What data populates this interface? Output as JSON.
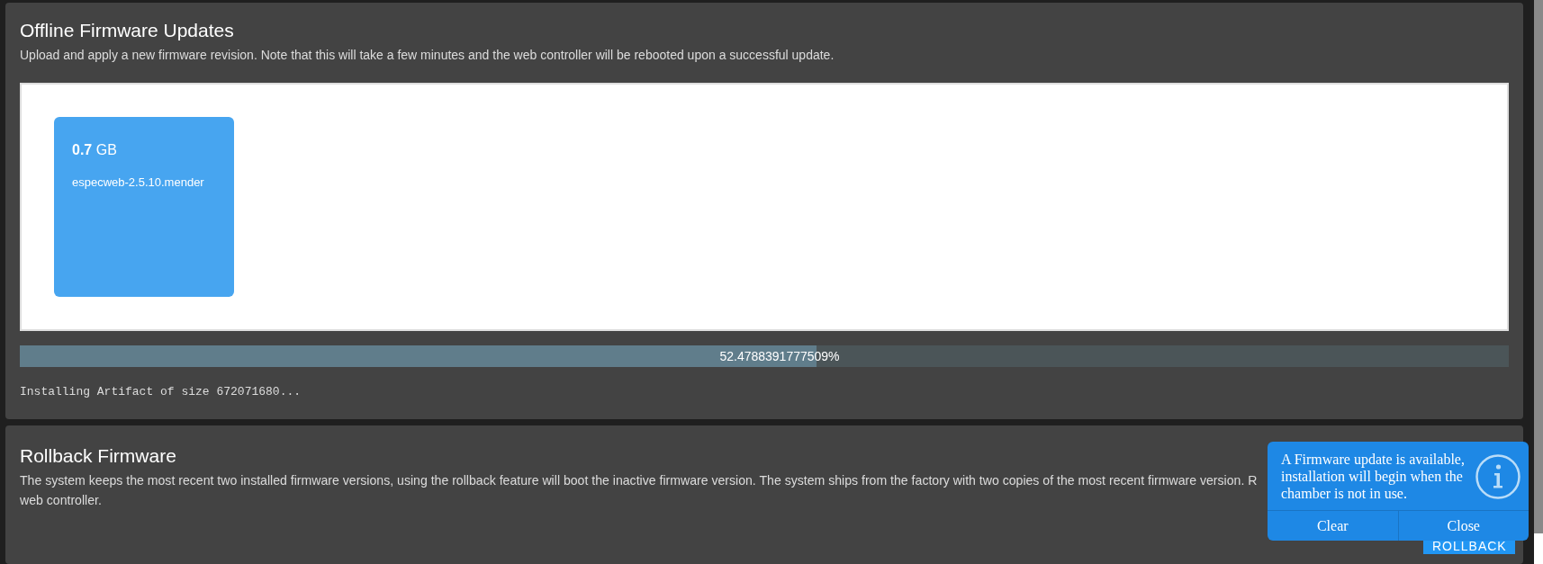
{
  "firmware_update": {
    "title": "Offline Firmware Updates",
    "description": "Upload and apply a new firmware revision. Note that this will take a few minutes and the web controller will be rebooted upon a successful update.",
    "upload_file": {
      "size": "**0.7** GB",
      "name": "especweb-2.5.10.mender"
    },
    "progress": {
      "level": 0.535,
      "label": "52.4788391777509%"
    },
    "log": "Installing Artifact of size 672071680..."
  },
  "rollback": {
    "title": "Rollback Firmware",
    "description_lines": [
      "The system keeps the most recent two installed firmware versions, using the rollback feature will boot the inactive firmware version. The system ships from the factory with two copies of the most recent firmware version. R",
      "web controller."
    ],
    "button": "ROLLBACK"
  },
  "notification": {
    "message": "A Firmware update is available, installation will begin when the chamber is not in use.",
    "buttons": [
      "Clear",
      "Close"
    ]
  }
}
